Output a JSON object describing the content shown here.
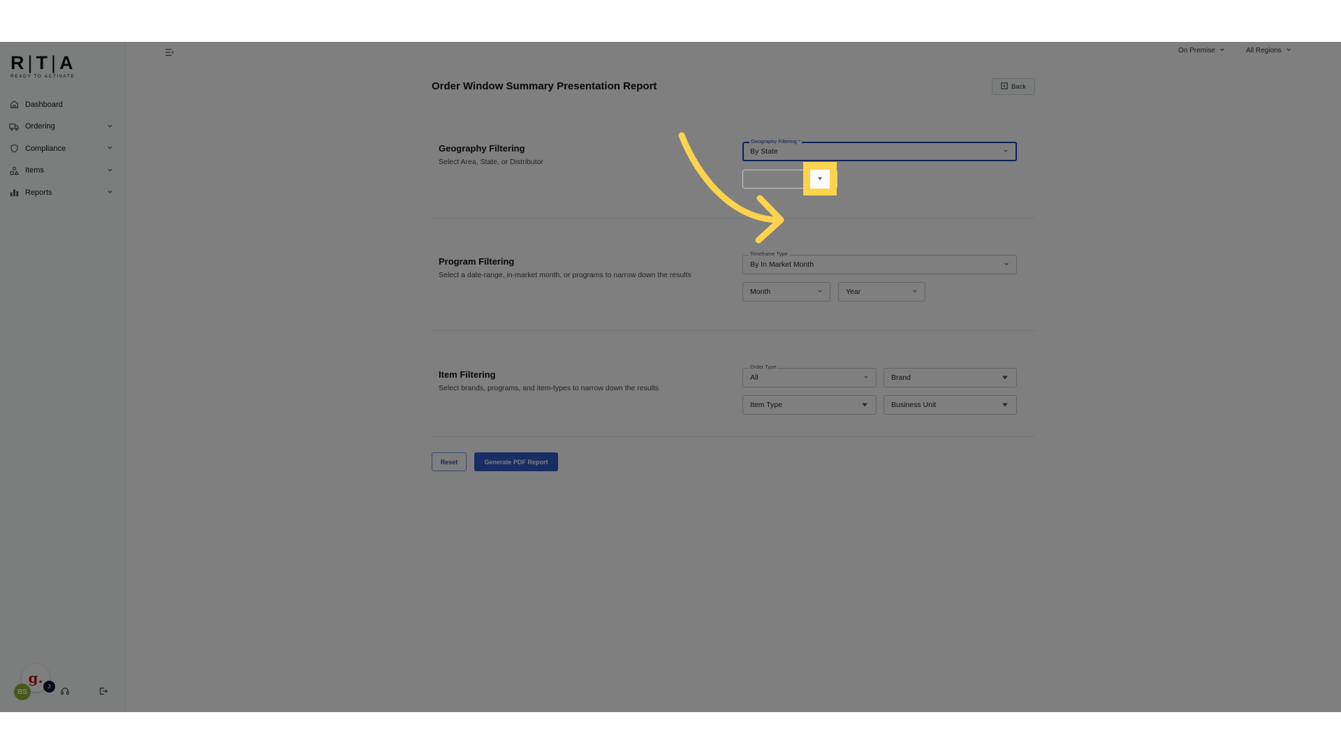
{
  "logo": {
    "mark_left": "R",
    "mark_mid": "T",
    "mark_right": "A",
    "tagline": "READY TO ACTIVATE"
  },
  "sidebar": {
    "items": [
      {
        "label": "Dashboard",
        "icon": "home-icon",
        "expandable": false
      },
      {
        "label": "Ordering",
        "icon": "truck-icon",
        "expandable": true
      },
      {
        "label": "Compliance",
        "icon": "shield-icon",
        "expandable": true
      },
      {
        "label": "Items",
        "icon": "shapes-icon",
        "expandable": true
      },
      {
        "label": "Reports",
        "icon": "bar-chart-icon",
        "expandable": true
      }
    ],
    "bottom": {
      "assistant_letter": "g.",
      "avatar_initials": "BS",
      "notification_count": "3"
    }
  },
  "topbar": {
    "channel": "On Premise",
    "region": "All Regions"
  },
  "page": {
    "title": "Order Window Summary Presentation Report",
    "back_label": "Back"
  },
  "geography": {
    "title": "Geography Filtering",
    "description": "Select Area, State, or Distributor",
    "filter_label": "Geography Filtering *",
    "filter_value": "By State",
    "state_value": ""
  },
  "program": {
    "title": "Program Filtering",
    "description": "Select a date-range, in-market month, or programs to narrow down the results",
    "timeframe_label": "Timeframe Type",
    "timeframe_value": "By In Market Month",
    "month_placeholder": "Month",
    "year_placeholder": "Year"
  },
  "item": {
    "title": "Item Filtering",
    "description": "Select brands, programs, and item-types to narrow down the results",
    "order_type_label": "Order Type",
    "order_type_value": "All",
    "brand_placeholder": "Brand",
    "item_type_placeholder": "Item Type",
    "business_unit_placeholder": "Business Unit"
  },
  "actions": {
    "reset_label": "Reset",
    "generate_label": "Generate PDF Report"
  },
  "colors": {
    "primary": "#2e5bc7",
    "active_border": "#1e40af",
    "highlight": "#fcd34d",
    "avatar": "#8fb339"
  }
}
